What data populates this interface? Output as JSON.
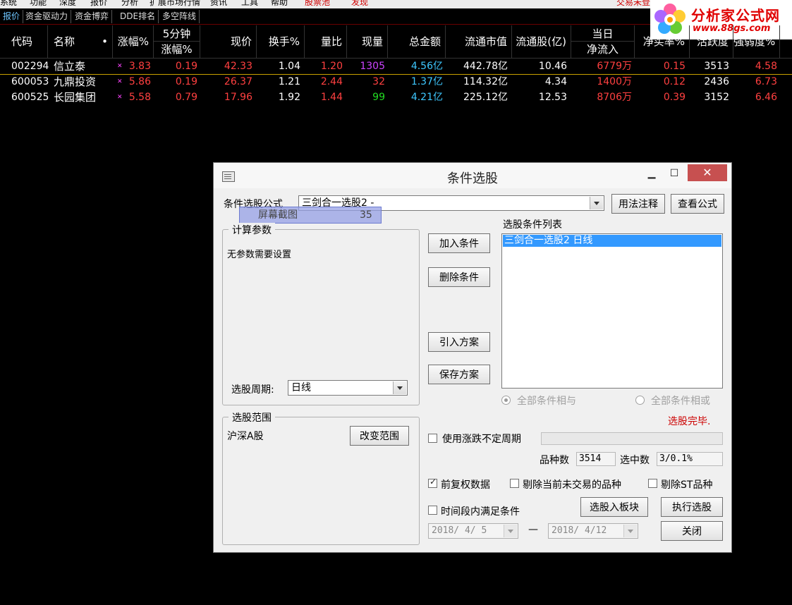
{
  "menu": {
    "items": [
      "系统",
      "功能",
      "深度",
      "报价",
      "分析",
      "扩展市场行情",
      "资讯",
      "工具",
      "帮助",
      "股票池",
      "发现"
    ],
    "status": "交易未登录"
  },
  "tabs": [
    "报价",
    "资金驱动力",
    "资金博弈",
    "DDE排名",
    "多空阵线"
  ],
  "logo": {
    "title": "分析家公式网",
    "url": "www.88gs.com"
  },
  "grid": {
    "headers": {
      "code": "代码",
      "name": "名称",
      "change_pct": "涨幅%",
      "five_min_top": "5分钟",
      "five_min_bottom": "涨幅%",
      "price": "现价",
      "turnover": "换手%",
      "vol_ratio": "量比",
      "cur_vol": "现量",
      "amount": "总金额",
      "float_mv": "流通市值",
      "float_shares": "流通股(亿)",
      "day_top": "当日",
      "day_bottom": "净流入",
      "net_buy_rate": "净买率%",
      "activity": "活跃度",
      "strength": "强弱度%"
    },
    "rows": [
      {
        "code": "002294",
        "name": "信立泰",
        "change_pct": "3.83",
        "five_min": "0.19",
        "price": "42.33",
        "turnover": "1.04",
        "vol_ratio": "1.20",
        "cur_vol": "1305",
        "amount": "4.56亿",
        "float_mv": "442.78亿",
        "float_shares": "10.46",
        "net_inflow": "6779万",
        "net_buy_rate": "0.15",
        "activity": "3513",
        "strength": "4.58"
      },
      {
        "code": "600053",
        "name": "九鼎投资",
        "change_pct": "5.86",
        "five_min": "0.19",
        "price": "26.37",
        "turnover": "1.21",
        "vol_ratio": "2.44",
        "cur_vol": "32",
        "amount": "1.37亿",
        "float_mv": "114.32亿",
        "float_shares": "4.34",
        "net_inflow": "1400万",
        "net_buy_rate": "0.12",
        "activity": "2436",
        "strength": "6.73"
      },
      {
        "code": "600525",
        "name": "长园集团",
        "change_pct": "5.58",
        "five_min": "0.79",
        "price": "17.96",
        "turnover": "1.92",
        "vol_ratio": "1.44",
        "cur_vol": "99",
        "amount": "4.21亿",
        "float_mv": "225.12亿",
        "float_shares": "12.53",
        "net_inflow": "8706万",
        "net_buy_rate": "0.39",
        "activity": "3152",
        "strength": "6.46"
      }
    ]
  },
  "dialog": {
    "title": "条件选股",
    "formula_label": "条件选股公式",
    "formula_value": "三剑合一选股2 -",
    "usage_btn": "用法注释",
    "view_formula_btn": "查看公式",
    "overlay_text": "屏幕截图",
    "overlay_num": "35",
    "params_group": "计算参数",
    "no_params": "无参数需要设置",
    "period_label": "选股周期:",
    "period_value": "日线",
    "scope_group": "选股范围",
    "scope_value": "沪深A股",
    "change_scope_btn": "改变范围",
    "add_btn": "加入条件",
    "delete_btn": "删除条件",
    "import_btn": "引入方案",
    "save_btn": "保存方案",
    "list_label": "选股条件列表",
    "list_items": [
      "三剑合一选股2  日线"
    ],
    "radio_and": "全部条件相与",
    "radio_or": "全部条件相或",
    "status": "选股完毕.",
    "uncertain_period": "使用涨跌不定周期",
    "count_label": "品种数",
    "count_value": "3514",
    "selected_label": "选中数",
    "selected_value": "3/0.1%",
    "fq_label": "前复权数据",
    "exclude_untraded": "剔除当前未交易的品种",
    "exclude_st": "剔除ST品种",
    "time_range_label": "时间段内满足条件",
    "to_block_btn": "选股入板块",
    "execute_btn": "执行选股",
    "date_from": "2018/ 4/ 5",
    "date_sep": "—",
    "date_to": "2018/ 4/12",
    "close_btn": "关闭"
  }
}
